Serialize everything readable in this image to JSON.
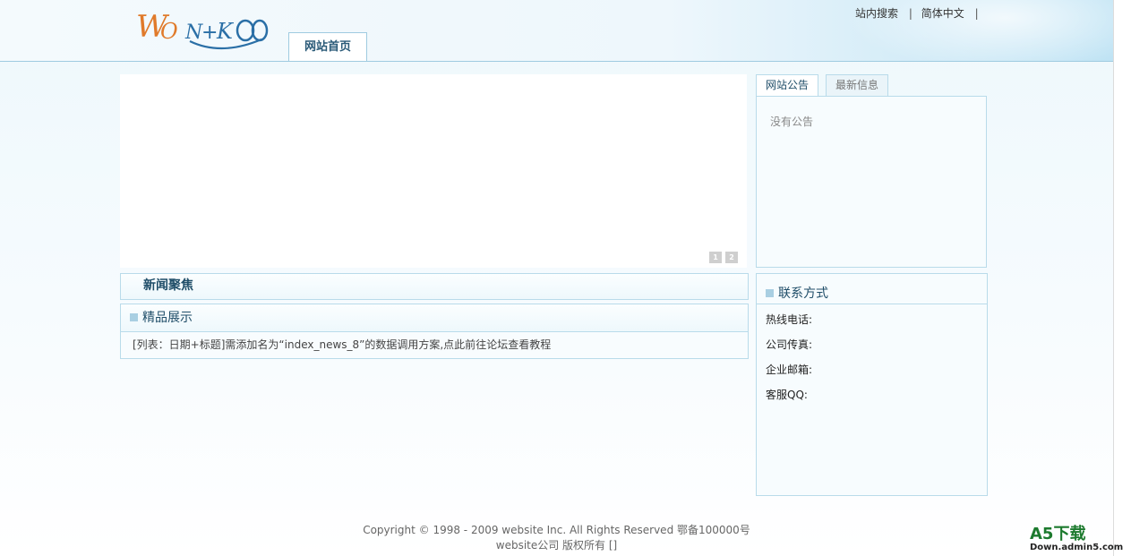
{
  "header": {
    "logo_text": "WONKOO",
    "top_links": [
      "站内搜索",
      "简体中文"
    ],
    "separator": "|",
    "nav_tab": "网站首页"
  },
  "banner": {
    "slide_buttons": [
      "1",
      "2"
    ]
  },
  "news": {
    "title": "新闻聚焦"
  },
  "products": {
    "title": "精品展示",
    "body_text": "[列表：日期+标题]需添加名为“index_news_8”的数据调用方案,点此前往论坛查看教程"
  },
  "sidebar": {
    "tabs": [
      "网站公告",
      "最新信息"
    ],
    "notice_text": "没有公告",
    "contact": {
      "title": "联系方式",
      "rows": [
        "热线电话:",
        "公司传真:",
        "企业邮箱:",
        "客服QQ:"
      ]
    }
  },
  "footer": {
    "line1": "Copyright © 1998 - 2009 website Inc. All Rights Reserved 鄂备100000号",
    "line2": "website公司 版权所有 []"
  },
  "watermark": {
    "main": "A5下载",
    "sub": "Down.admin5.com"
  },
  "colors": {
    "accent_blue": "#1f4d68",
    "border_blue": "#b9dbea",
    "logo_orange": "#e07a2a",
    "logo_blue": "#2a6fa6"
  }
}
